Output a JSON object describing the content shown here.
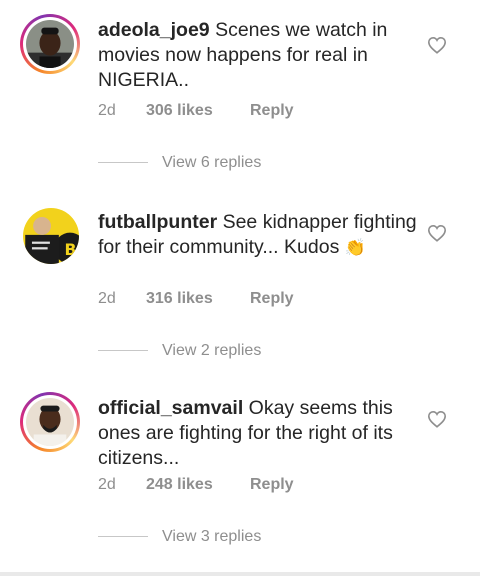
{
  "comments": [
    {
      "username": "adeola_joe9",
      "text": "Scenes we watch in movies now happens for real in NIGERIA..",
      "emoji": "",
      "time": "2d",
      "likes": "306 likes",
      "reply": "Reply",
      "view_replies": "View 6 replies",
      "has_story": true
    },
    {
      "username": "futballpunter",
      "text": "See kidnapper fighting for their community... Kudos",
      "emoji": "👏",
      "time": "2d",
      "likes": "316 likes",
      "reply": "Reply",
      "view_replies": "View 2 replies",
      "has_story": false
    },
    {
      "username": "official_samvail",
      "text": "Okay seems this ones are fighting for the right of its citizens...",
      "emoji": "",
      "time": "2d",
      "likes": "248 likes",
      "reply": "Reply",
      "view_replies": "View 3 replies",
      "has_story": true
    }
  ],
  "icons": {
    "like": "heart-outline-icon",
    "clap": "clapping-hands-emoji"
  },
  "colors": {
    "text": "#262626",
    "muted": "#8e8e8e",
    "story_ring": [
      "#f58529",
      "#dd2a7b",
      "#8134af"
    ]
  }
}
